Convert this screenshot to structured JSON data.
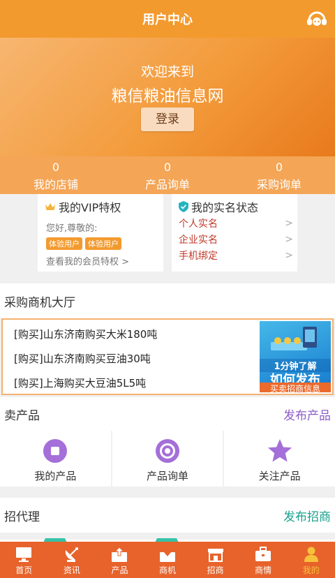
{
  "header": {
    "title": "用户中心",
    "service_icon": "customer-service-icon"
  },
  "banner": {
    "welcome": "欢迎来到",
    "site_name": "粮信粮油信息网",
    "login_label": "登录"
  },
  "stats": [
    {
      "value": "0",
      "label": "我的店铺"
    },
    {
      "value": "0",
      "label": "产品询单"
    },
    {
      "value": "0",
      "label": "采购询单"
    }
  ],
  "vip": {
    "title": "我的VIP特权",
    "greeting": "您好,尊敬的:",
    "badges": [
      "体验用户",
      "体验用户"
    ],
    "link": "查看我的会员特权 >"
  },
  "realname": {
    "title": "我的实名状态",
    "items": [
      "个人实名",
      "企业实名",
      "手机绑定"
    ]
  },
  "purchase_hall": {
    "title": "采购商机大厅",
    "rows": [
      "[购买]山东济南购买大米180吨",
      "[购买]山东济南购买豆油30吨",
      "[购买]上海购买大豆油5L5吨"
    ],
    "ad": {
      "line1": "1分钟了解",
      "line2": "如何发布",
      "line3": "买卖招商信息"
    }
  },
  "sell": {
    "title": "卖产品",
    "action": "发布产品",
    "tiles": [
      {
        "label": "我的产品",
        "icon": "stop-circle-icon"
      },
      {
        "label": "产品询单",
        "icon": "target-icon"
      },
      {
        "label": "关注产品",
        "icon": "star-icon"
      }
    ]
  },
  "agents": {
    "title": "招代理",
    "action": "发布招商"
  },
  "tabbar": [
    {
      "label": "首页",
      "icon": "monitor-icon"
    },
    {
      "label": "资讯",
      "icon": "satellite-dish-icon"
    },
    {
      "label": "产品",
      "icon": "box-upload-icon"
    },
    {
      "label": "商机",
      "icon": "box-download-icon"
    },
    {
      "label": "招商",
      "icon": "storefront-icon"
    },
    {
      "label": "商情",
      "icon": "briefcase-icon"
    },
    {
      "label": "我的",
      "icon": "person-icon",
      "active": true
    }
  ],
  "colors": {
    "brand_orange": "#f39a2e",
    "tab_orange": "#e7632b",
    "purple": "#8e5cc9",
    "teal": "#1aa08d",
    "active_tab": "#f7c13c"
  }
}
